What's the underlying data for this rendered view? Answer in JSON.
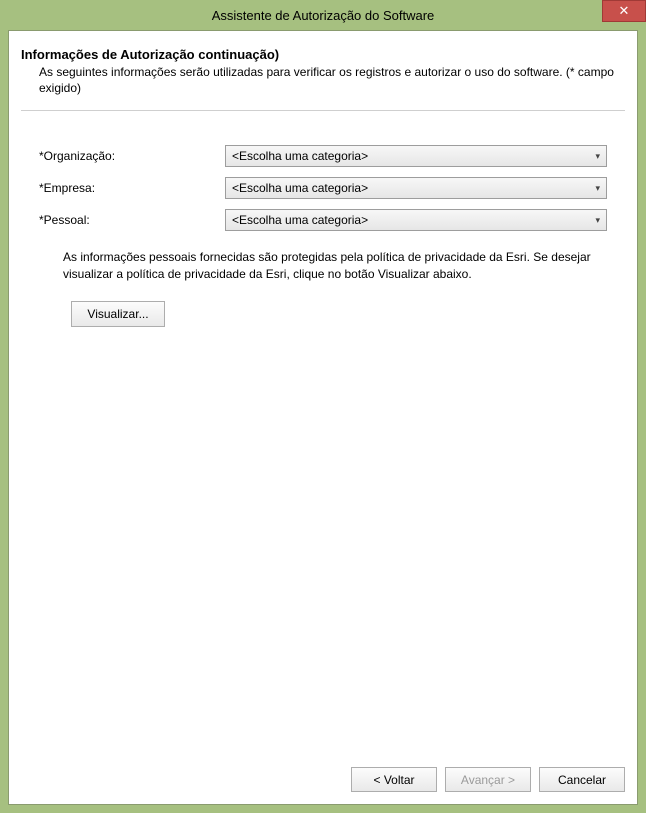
{
  "window": {
    "title": "Assistente de Autorização do Software"
  },
  "header": {
    "title": "Informações de Autorização continuação)",
    "subtitle": "As seguintes informações serão utilizadas para verificar os registros e autorizar o uso do software. (* campo exigido)"
  },
  "form": {
    "org_label": "*Organização:",
    "org_value": "<Escolha uma categoria>",
    "empresa_label": "*Empresa:",
    "empresa_value": "<Escolha uma categoria>",
    "pessoal_label": "*Pessoal:",
    "pessoal_value": "<Escolha uma categoria>"
  },
  "privacy": {
    "text": "As informações pessoais fornecidas são protegidas pela política de privacidade da Esri. Se desejar visualizar a política de privacidade da Esri, clique no botão Visualizar abaixo.",
    "view_label": "Visualizar..."
  },
  "footer": {
    "back": "< Voltar",
    "next": "Avançar >",
    "cancel": "Cancelar"
  }
}
